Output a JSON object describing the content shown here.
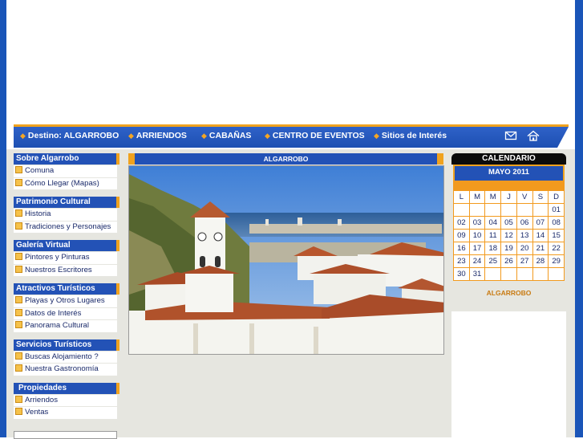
{
  "nav": {
    "items": [
      "Destino: ALGARROBO",
      "ARRIENDOS",
      "CABAÑAS",
      "CENTRO DE EVENTOS",
      "Sitios de Interés"
    ],
    "icons": [
      "mail-icon",
      "home-icon"
    ]
  },
  "sidebar": {
    "sections": [
      {
        "title": "Sobre Algarrobo",
        "items": [
          "Comuna",
          "Cómo Llegar (Mapas)"
        ]
      },
      {
        "title": "Patrimonio Cultural",
        "items": [
          "Historia",
          "Tradiciones y Personajes"
        ]
      },
      {
        "title": "Galería Virtual",
        "items": [
          "Pintores y Pinturas",
          "Nuestros Escritores"
        ]
      },
      {
        "title": "Atractivos Turísticos",
        "items": [
          "Playas y Otros Lugares",
          "Datos de Interés",
          "Panorama Cultural"
        ]
      },
      {
        "title": "Servicios Turísticos",
        "items": [
          "Buscas Alojamiento ?",
          "Nuestra Gastronomía"
        ]
      },
      {
        "title": "Propiedades",
        "items": [
          "Arriendos",
          "Ventas"
        ]
      }
    ]
  },
  "center": {
    "title": "ALGARROBO"
  },
  "calendar": {
    "title": "CALENDARIO",
    "month": "MAYO 2011",
    "weekdays": [
      "L",
      "M",
      "M",
      "J",
      "V",
      "S",
      "D"
    ],
    "weeks": [
      [
        "",
        "",
        "",
        "",
        "",
        "",
        "01"
      ],
      [
        "02",
        "03",
        "04",
        "05",
        "06",
        "07",
        "08"
      ],
      [
        "09",
        "10",
        "11",
        "12",
        "13",
        "14",
        "15"
      ],
      [
        "16",
        "17",
        "18",
        "19",
        "20",
        "21",
        "22"
      ],
      [
        "23",
        "24",
        "25",
        "26",
        "27",
        "28",
        "29"
      ],
      [
        "30",
        "31",
        "",
        "",
        "",
        "",
        ""
      ]
    ],
    "footer": "ALGARROBO"
  },
  "colors": {
    "brand_blue": "#2352b6",
    "accent_orange": "#f0a21e"
  }
}
